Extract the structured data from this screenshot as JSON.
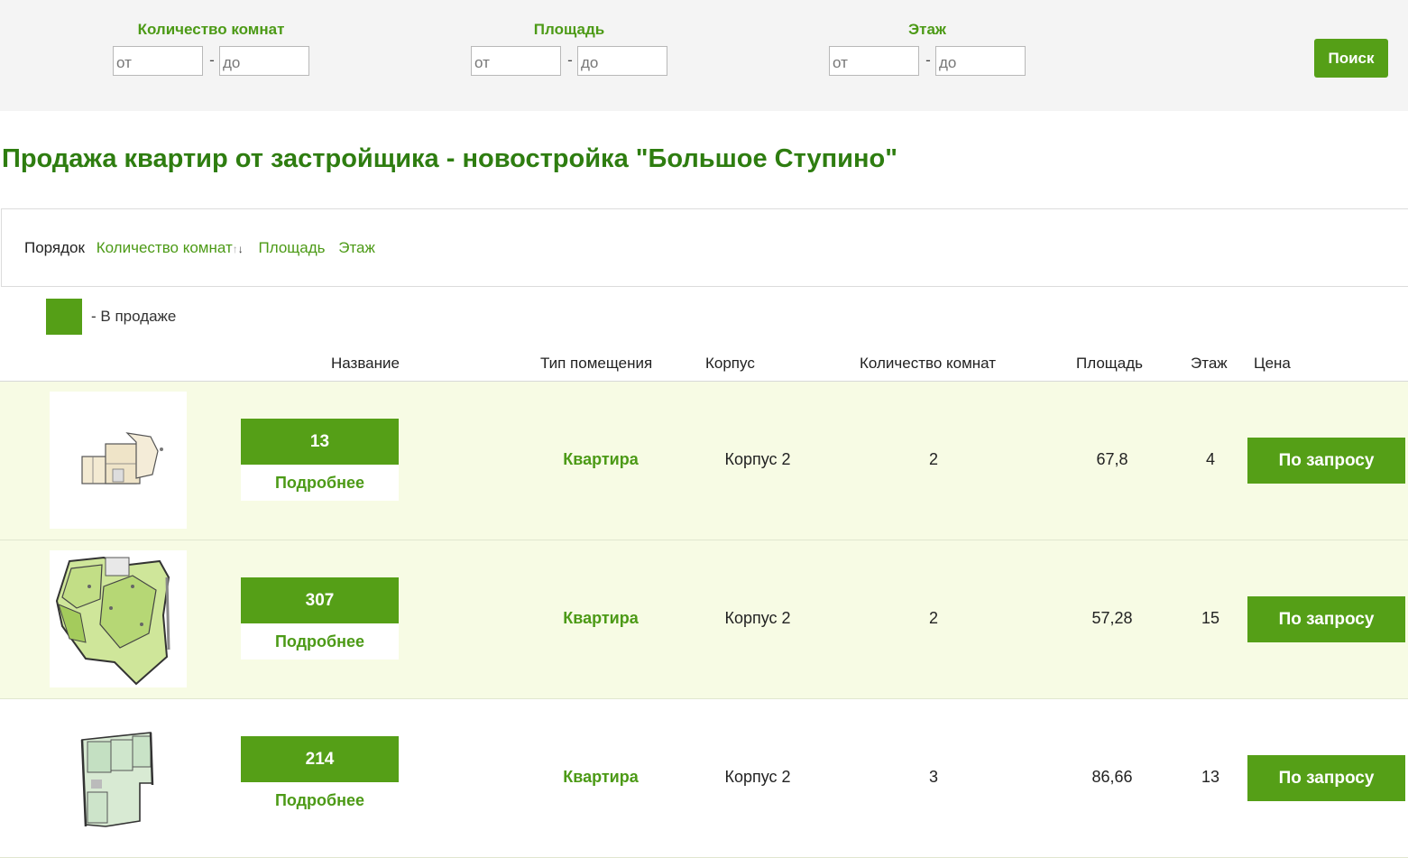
{
  "filters": [
    {
      "label": "Количество комнат",
      "from_placeholder": "от",
      "to_placeholder": "до",
      "dash": "-"
    },
    {
      "label": "Площадь",
      "from_placeholder": "от",
      "to_placeholder": "до",
      "dash": "-"
    },
    {
      "label": "Этаж",
      "from_placeholder": "от",
      "to_placeholder": "до",
      "dash": "-"
    }
  ],
  "search_label": "Поиск",
  "title": "Продажа квартир от застройщика - новостройка \"Большое Ступино\"",
  "sort": {
    "label": "Порядок",
    "options": [
      "Количество комнат",
      "Площадь",
      "Этаж"
    ],
    "arrow_up": "↑",
    "arrow_down": "↓"
  },
  "legend": {
    "text": "- В продаже",
    "color": "#559f17"
  },
  "table": {
    "headers": [
      "Название",
      "Тип помещения",
      "Корпус",
      "Количество комнат",
      "Площадь",
      "Этаж",
      "Цена"
    ],
    "rows": [
      {
        "number": "13",
        "more": "Подробнее",
        "type": "Квартира",
        "corpus": "Корпус 2",
        "rooms": "2",
        "area": "67,8",
        "floor": "4",
        "price": "По запросу"
      },
      {
        "number": "307",
        "more": "Подробнее",
        "type": "Квартира",
        "corpus": "Корпус 2",
        "rooms": "2",
        "area": "57,28",
        "floor": "15",
        "price": "По запросу"
      },
      {
        "number": "214",
        "more": "Подробнее",
        "type": "Квартира",
        "corpus": "Корпус 2",
        "rooms": "3",
        "area": "86,66",
        "floor": "13",
        "price": "По запросу"
      }
    ]
  },
  "colors": {
    "accent": "#559f17",
    "title": "#2e7d10",
    "row_highlight": "#f7fbe4"
  }
}
